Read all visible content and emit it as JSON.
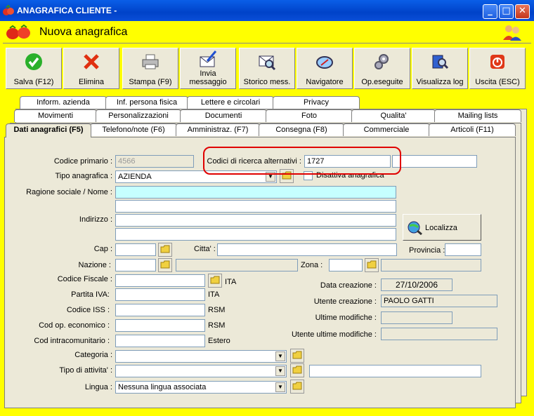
{
  "window": {
    "title": "ANAGRAFICA CLIENTE -",
    "header": "Nuova anagrafica"
  },
  "toolbar": {
    "salva": "Salva (F12)",
    "elimina": "Elimina",
    "stampa": "Stampa (F9)",
    "invia1": "Invia",
    "invia2": "messaggio",
    "storico": "Storico mess.",
    "navigatore": "Navigatore",
    "opeseguite": "Op.eseguite",
    "log": "Visualizza log",
    "uscita": "Uscita (ESC)"
  },
  "tabs": {
    "row3": [
      "Inform. azienda",
      "Inf. persona fisica",
      "Lettere e circolari",
      "Privacy"
    ],
    "row2": [
      "Movimenti",
      "Personalizzazioni",
      "Documenti",
      "Foto",
      "Qualita'",
      "Mailing lists"
    ],
    "row1": [
      "Dati anagrafici (F5)",
      "Telefono/note (F6)",
      "Amministraz. (F7)",
      "Consegna (F8)",
      "Commerciale",
      "Articoli (F11)"
    ]
  },
  "form": {
    "codice_primario_label": "Codice primario :",
    "codice_primario": "4566",
    "codici_ricerca_label": "Codici di ricerca alternativi :",
    "codici_ricerca": "1727",
    "codici_ricerca2": "",
    "tipo_label": "Tipo anagrafica :",
    "tipo": "AZIENDA",
    "disattiva": "Disattiva anagrafica",
    "ragione_label": "Ragione sociale / Nome :",
    "ragione1": "",
    "ragione2": "",
    "indirizzo_label": "Indirizzo :",
    "indirizzo1": "",
    "indirizzo2": "",
    "localizza": "Localizza",
    "cap_label": "Cap :",
    "citta_label": "Citta' :",
    "provincia_label": "Provincia :",
    "nazione_label": "Nazione :",
    "zona_label": "Zona :",
    "cf_label": "Codice Fiscale :",
    "cf_suffix": "ITA",
    "piva_label": "Partita IVA:",
    "piva_suffix": "ITA",
    "iss_label": "Codice ISS :",
    "iss_suffix": "RSM",
    "coe_label": "Cod  op. economico :",
    "coe_suffix": "RSM",
    "cic_label": "Cod  intracomunitario :",
    "cic_suffix": "Estero",
    "categoria_label": "Categoria :",
    "attivita_label": "Tipo di attivita' :",
    "lingua_label": "Lingua :",
    "lingua": "Nessuna lingua associata",
    "data_creazione_label": "Data creazione :",
    "data_creazione": "27/10/2006",
    "utente_creazione_label": "Utente creazione :",
    "utente_creazione": "PAOLO GATTI",
    "ultime_mod_label": "Ultime modifiche :",
    "ultime_mod": "",
    "utente_ultime_label": "Utente ultime modifiche :",
    "utente_ultime": ""
  }
}
